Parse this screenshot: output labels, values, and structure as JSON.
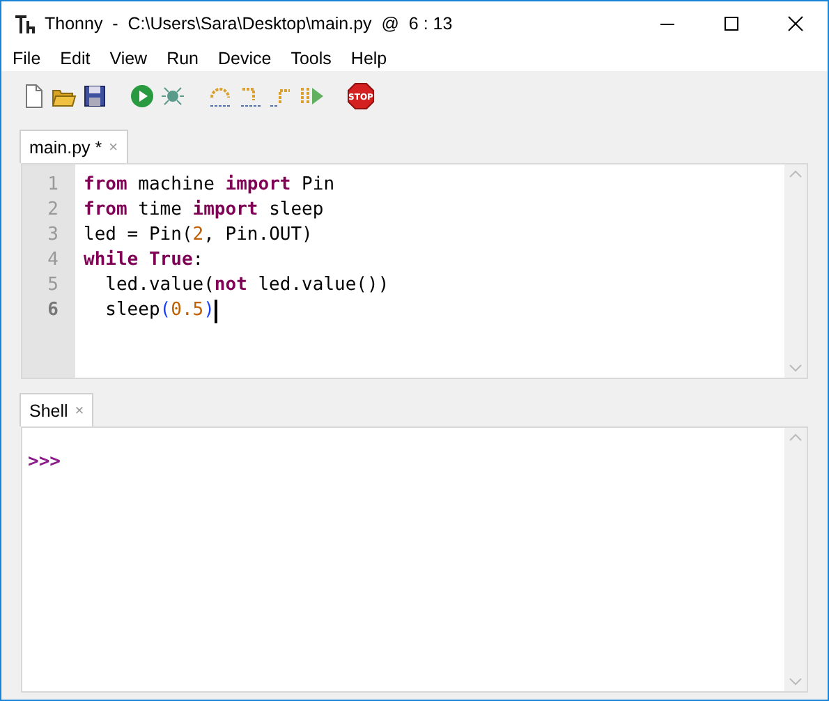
{
  "window": {
    "title": "Thonny  -  C:\\Users\\Sara\\Desktop\\main.py  @  6 : 13"
  },
  "menu": [
    "File",
    "Edit",
    "View",
    "Run",
    "Device",
    "Tools",
    "Help"
  ],
  "toolbar": {
    "stop_label": "STOP"
  },
  "editor": {
    "tabs": [
      {
        "label": "main.py *",
        "close": "×",
        "selected": true
      }
    ],
    "lines": [
      {
        "number": "1",
        "current": false,
        "tokens": [
          {
            "text": "from",
            "kind": "keyword"
          },
          {
            "text": " machine ",
            "kind": "name"
          },
          {
            "text": "import",
            "kind": "keyword"
          },
          {
            "text": " Pin",
            "kind": "name"
          }
        ]
      },
      {
        "number": "2",
        "current": false,
        "tokens": [
          {
            "text": "from",
            "kind": "keyword"
          },
          {
            "text": " time ",
            "kind": "name"
          },
          {
            "text": "import",
            "kind": "keyword"
          },
          {
            "text": " sleep",
            "kind": "name"
          }
        ]
      },
      {
        "number": "3",
        "current": false,
        "tokens": [
          {
            "text": "led = Pin(",
            "kind": "name"
          },
          {
            "text": "2",
            "kind": "number"
          },
          {
            "text": ", Pin.OUT)",
            "kind": "name"
          }
        ]
      },
      {
        "number": "4",
        "current": false,
        "tokens": [
          {
            "text": "while",
            "kind": "keyword"
          },
          {
            "text": " True",
            "kind": "keyword"
          },
          {
            "text": ":",
            "kind": "name"
          }
        ]
      },
      {
        "number": "5",
        "current": false,
        "tokens": [
          {
            "text": "  led.value(",
            "kind": "name"
          },
          {
            "text": "not",
            "kind": "keyword"
          },
          {
            "text": " led.value())",
            "kind": "name"
          }
        ]
      },
      {
        "number": "6",
        "current": true,
        "tokens": [
          {
            "text": "  sleep",
            "kind": "name"
          },
          {
            "text": "(",
            "kind": "bracket"
          },
          {
            "text": "0.5",
            "kind": "number"
          },
          {
            "text": ")",
            "kind": "bracket"
          }
        ]
      }
    ]
  },
  "shell": {
    "tabs": [
      {
        "label": "Shell",
        "close": "×",
        "selected": true
      }
    ],
    "prompt": ">>>"
  }
}
